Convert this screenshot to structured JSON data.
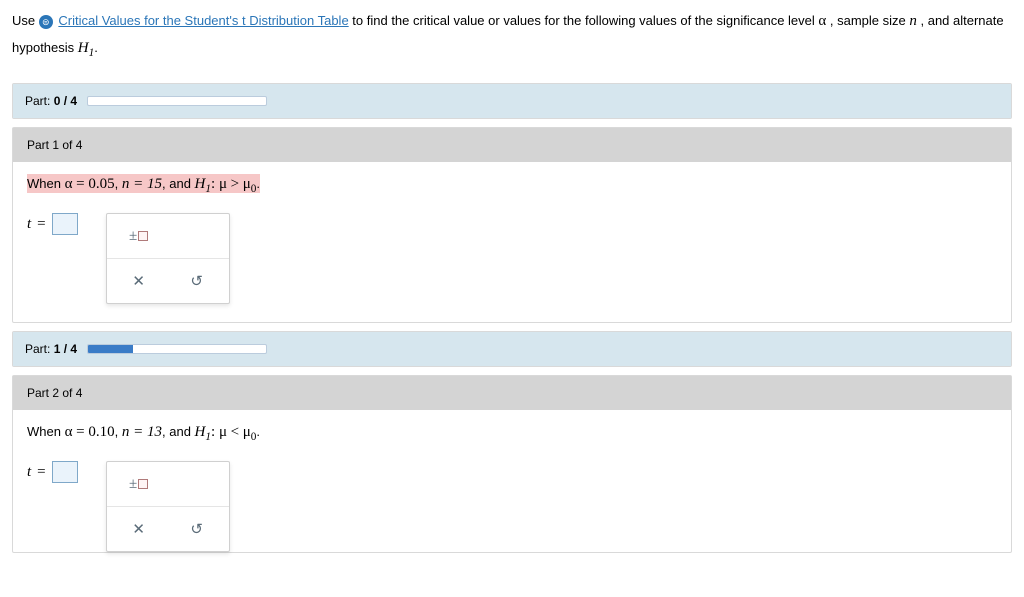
{
  "instruction": {
    "pre": "Use ",
    "link": "Critical Values for the Student's t Distribution Table",
    "mid": " to find the critical value or values for the following values of the significance level ",
    "alpha": "α",
    "mid2": ", sample size ",
    "n": "n",
    "mid3": ", and alternate hypothesis ",
    "h1": "H",
    "h1sub": "1",
    "end": "."
  },
  "progress1": {
    "label": "Part:",
    "value": "0 / 4",
    "fill": 0
  },
  "part1": {
    "title": "Part 1 of 4",
    "q_pre": "When ",
    "alpha_eq": "α = 0.05",
    "comma1": ", ",
    "n_eq": "n = 15",
    "comma2": ", and ",
    "h1": "H",
    "h1sub": "1",
    "colon": ": ",
    "mu": "μ",
    "rel": ">",
    "mu0": "μ",
    "mu0sub": "0",
    "dot": ".",
    "t_label": "t",
    "eq": "="
  },
  "progress2": {
    "label": "Part:",
    "value": "1 / 4",
    "fill": 25
  },
  "part2": {
    "title": "Part 2 of 4",
    "q_pre": "When ",
    "alpha_eq": "α = 0.10",
    "comma1": ", ",
    "n_eq": "n = 13",
    "comma2": ", and ",
    "h1": "H",
    "h1sub": "1",
    "colon": ": ",
    "mu": "μ",
    "rel": "<",
    "mu0": "μ",
    "mu0sub": "0",
    "dot": ".",
    "t_label": "t",
    "eq": "="
  },
  "tools": {
    "pm": "±",
    "x": "✕",
    "reset": "↺"
  }
}
